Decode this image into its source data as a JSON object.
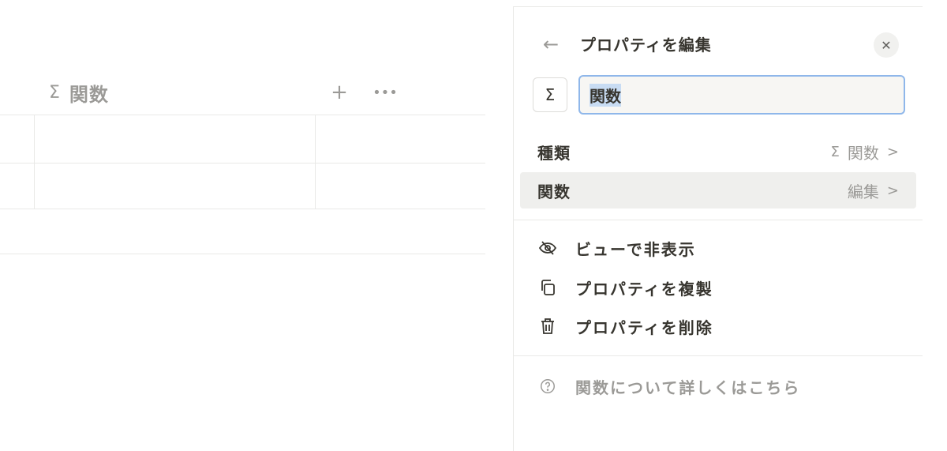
{
  "table": {
    "column_name": "関数",
    "column_type_icon": "Σ",
    "add_symbol": "+",
    "more_symbol": "•••"
  },
  "panel": {
    "title": "プロパティを編集",
    "back_icon": "←",
    "close_icon": "✕",
    "type_icon": "Σ",
    "name_input_value": "関数",
    "rows": [
      {
        "label": "種類",
        "value_icon": "Σ",
        "value": "関数",
        "chevron": ">"
      },
      {
        "label": "関数",
        "value_icon": "",
        "value": "編集",
        "chevron": ">"
      }
    ],
    "actions": [
      {
        "icon": "eye-off-icon",
        "label": "ビューで非表示"
      },
      {
        "icon": "duplicate-icon",
        "label": "プロパティを複製"
      },
      {
        "icon": "trash-icon",
        "label": "プロパティを削除"
      }
    ],
    "help": {
      "icon": "help-circle-icon",
      "label": "関数について詳しくはこちら"
    }
  },
  "colors": {
    "text": "#37352f",
    "muted": "#9b9a97",
    "border": "#e9e9e7",
    "focus": "#8fb7ea",
    "highlight": "#efefed"
  }
}
